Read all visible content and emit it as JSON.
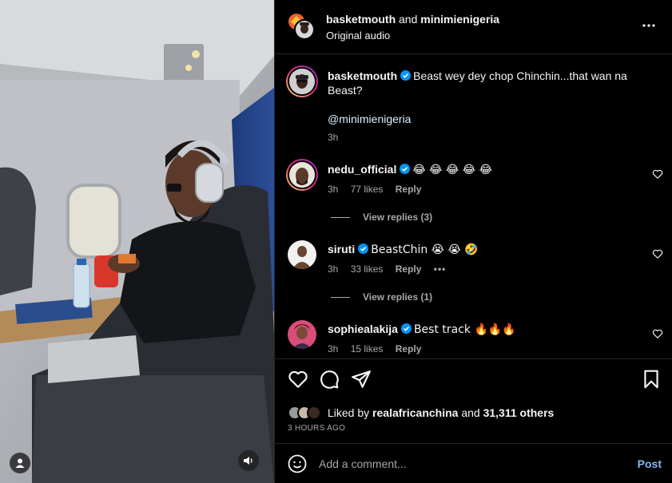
{
  "header": {
    "user1": "basketmouth",
    "joiner": "and",
    "user2": "minimienigeria",
    "audio": "Original audio",
    "more_icon": "more-horizontal-icon"
  },
  "caption": {
    "username": "basketmouth",
    "text": "Beast wey dey chop Chinchin...that wan na Beast?",
    "mention": "@minimienigeria",
    "time": "3h"
  },
  "comments": [
    {
      "username": "nedu_official",
      "text": "😂 😂 😂 😂 😂",
      "time": "3h",
      "likes": "77 likes",
      "reply": "Reply",
      "view_replies": "View replies (3)"
    },
    {
      "username": "siruti",
      "text": "BeastChin 😭 😭 🤣",
      "time": "3h",
      "likes": "33 likes",
      "reply": "Reply",
      "more": "•••",
      "view_replies": "View replies (1)"
    },
    {
      "username": "sophiealakija",
      "text": "Best track 🔥🔥🔥",
      "time": "3h",
      "likes": "15 likes",
      "reply": "Reply"
    }
  ],
  "likes": {
    "prefix": "Liked by",
    "user": "realafricanchina",
    "joiner": "and",
    "others": "31,311 others"
  },
  "time_ago": "3 HOURS AGO",
  "comment_box": {
    "placeholder": "Add a comment...",
    "post_label": "Post"
  },
  "colors": {
    "background": "#000000",
    "divider": "#262626",
    "secondary_text": "#a8a8a8",
    "post_button": "#85b8f0",
    "verified": "#0095f6"
  }
}
